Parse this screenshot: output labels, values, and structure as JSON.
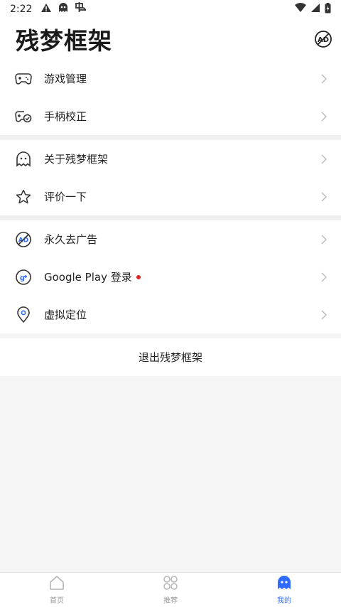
{
  "status_bar": {
    "time": "2:22"
  },
  "header": {
    "title": "残梦框架",
    "ad_icon": "no-ads-icon"
  },
  "sections": [
    {
      "items": [
        {
          "label": "游戏管理",
          "icon": "gamepad-icon"
        },
        {
          "label": "手柄校正",
          "icon": "gamepad-calibrate-icon"
        }
      ]
    },
    {
      "items": [
        {
          "label": "关于残梦框架",
          "icon": "ghost-icon"
        },
        {
          "label": "评价一下",
          "icon": "star-icon"
        }
      ]
    },
    {
      "items": [
        {
          "label": "永久去广告",
          "icon": "no-ads-icon"
        },
        {
          "label": "Google Play 登录",
          "icon": "google-plus-icon",
          "badge_dot": true
        },
        {
          "label": "虚拟定位",
          "icon": "location-pin-icon"
        }
      ]
    }
  ],
  "exit": {
    "label": "退出残梦框架"
  },
  "bottom_nav": {
    "items": [
      {
        "label": "首页",
        "icon": "home-icon",
        "active": false
      },
      {
        "label": "推荐",
        "icon": "recommend-icon",
        "active": false
      },
      {
        "label": "我的",
        "icon": "ghost-icon",
        "active": true
      }
    ]
  },
  "colors": {
    "accent": "#2f6bff",
    "badge": "#e02020",
    "divider": "#f0f0f0"
  }
}
